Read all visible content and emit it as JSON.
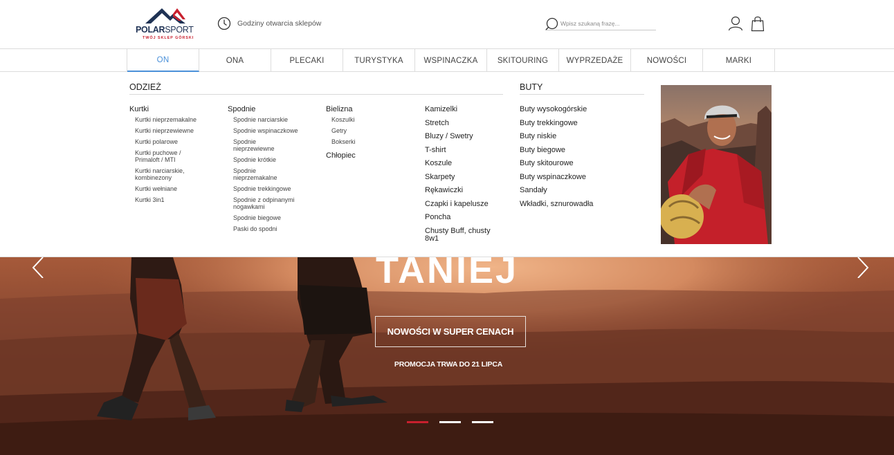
{
  "logo": {
    "name_bold": "POLAR",
    "name_regular": "SPORT",
    "tagline": "TWÓJ SKLEP GÓRSKI"
  },
  "header": {
    "hours_label": "Godziny otwarcia sklepów",
    "search_placeholder": "Wpisz szukaną frazę..."
  },
  "nav": {
    "items": [
      {
        "label": "ON"
      },
      {
        "label": "ONA"
      },
      {
        "label": "PLECAKI"
      },
      {
        "label": "TURYSTYKA"
      },
      {
        "label": "WSPINACZKA"
      },
      {
        "label": "SKITOURING"
      },
      {
        "label": "WYPRZEDAŻE"
      },
      {
        "label": "NOWOŚCI"
      },
      {
        "label": "MARKI"
      }
    ],
    "active_index": 0
  },
  "mega": {
    "clothes": {
      "title": "ODZIEŻ",
      "kurtki": {
        "label": "Kurtki",
        "items": [
          "Kurtki nieprzemakalne",
          "Kurtki nieprzewiewne",
          "Kurtki polarowe",
          "Kurtki puchowe / Primaloft / MTI",
          "Kurtki narciarskie, kombinezony",
          "Kurtki wełniane",
          "Kurtki 3in1"
        ]
      },
      "spodnie": {
        "label": "Spodnie",
        "items": [
          "Spodnie narciarskie",
          "Spodnie wspinaczkowe",
          "Spodnie nieprzewiewne",
          "Spodnie krótkie",
          "Spodnie nieprzemakalne",
          "Spodnie trekkingowe",
          "Spodnie z odpinanymi nogawkami",
          "Spodnie biegowe",
          "Paski do spodni"
        ]
      },
      "bielizna": {
        "label": "Bielizna",
        "items": [
          "Koszulki",
          "Getry",
          "Bokserki"
        ]
      },
      "chlopiec": "Chłopiec",
      "other": [
        "Kamizelki",
        "Stretch",
        "Bluzy / Swetry",
        "T-shirt",
        "Koszule",
        "Skarpety",
        "Rękawiczki",
        "Czapki i kapelusze",
        "Poncha",
        "Chusty Buff, chusty 8w1"
      ]
    },
    "shoes": {
      "title": "BUTY",
      "items": [
        "Buty wysokogórskie",
        "Buty trekkingowe",
        "Buty niskie",
        "Buty biegowe",
        "Buty skitourowe",
        "Buty wspinaczkowe",
        "Sandały",
        "Wkładki, sznurowadła"
      ]
    }
  },
  "hero": {
    "title": "TANIEJ",
    "button": "NOWOŚCI W SUPER CENACH",
    "promo": "PROMOCJA TRWA DO 21 LIPCA",
    "slide_count": 3,
    "active_slide": 0
  },
  "colors": {
    "accent": "#4a90d9",
    "brand_navy": "#1f3254",
    "brand_red": "#c8202e"
  }
}
